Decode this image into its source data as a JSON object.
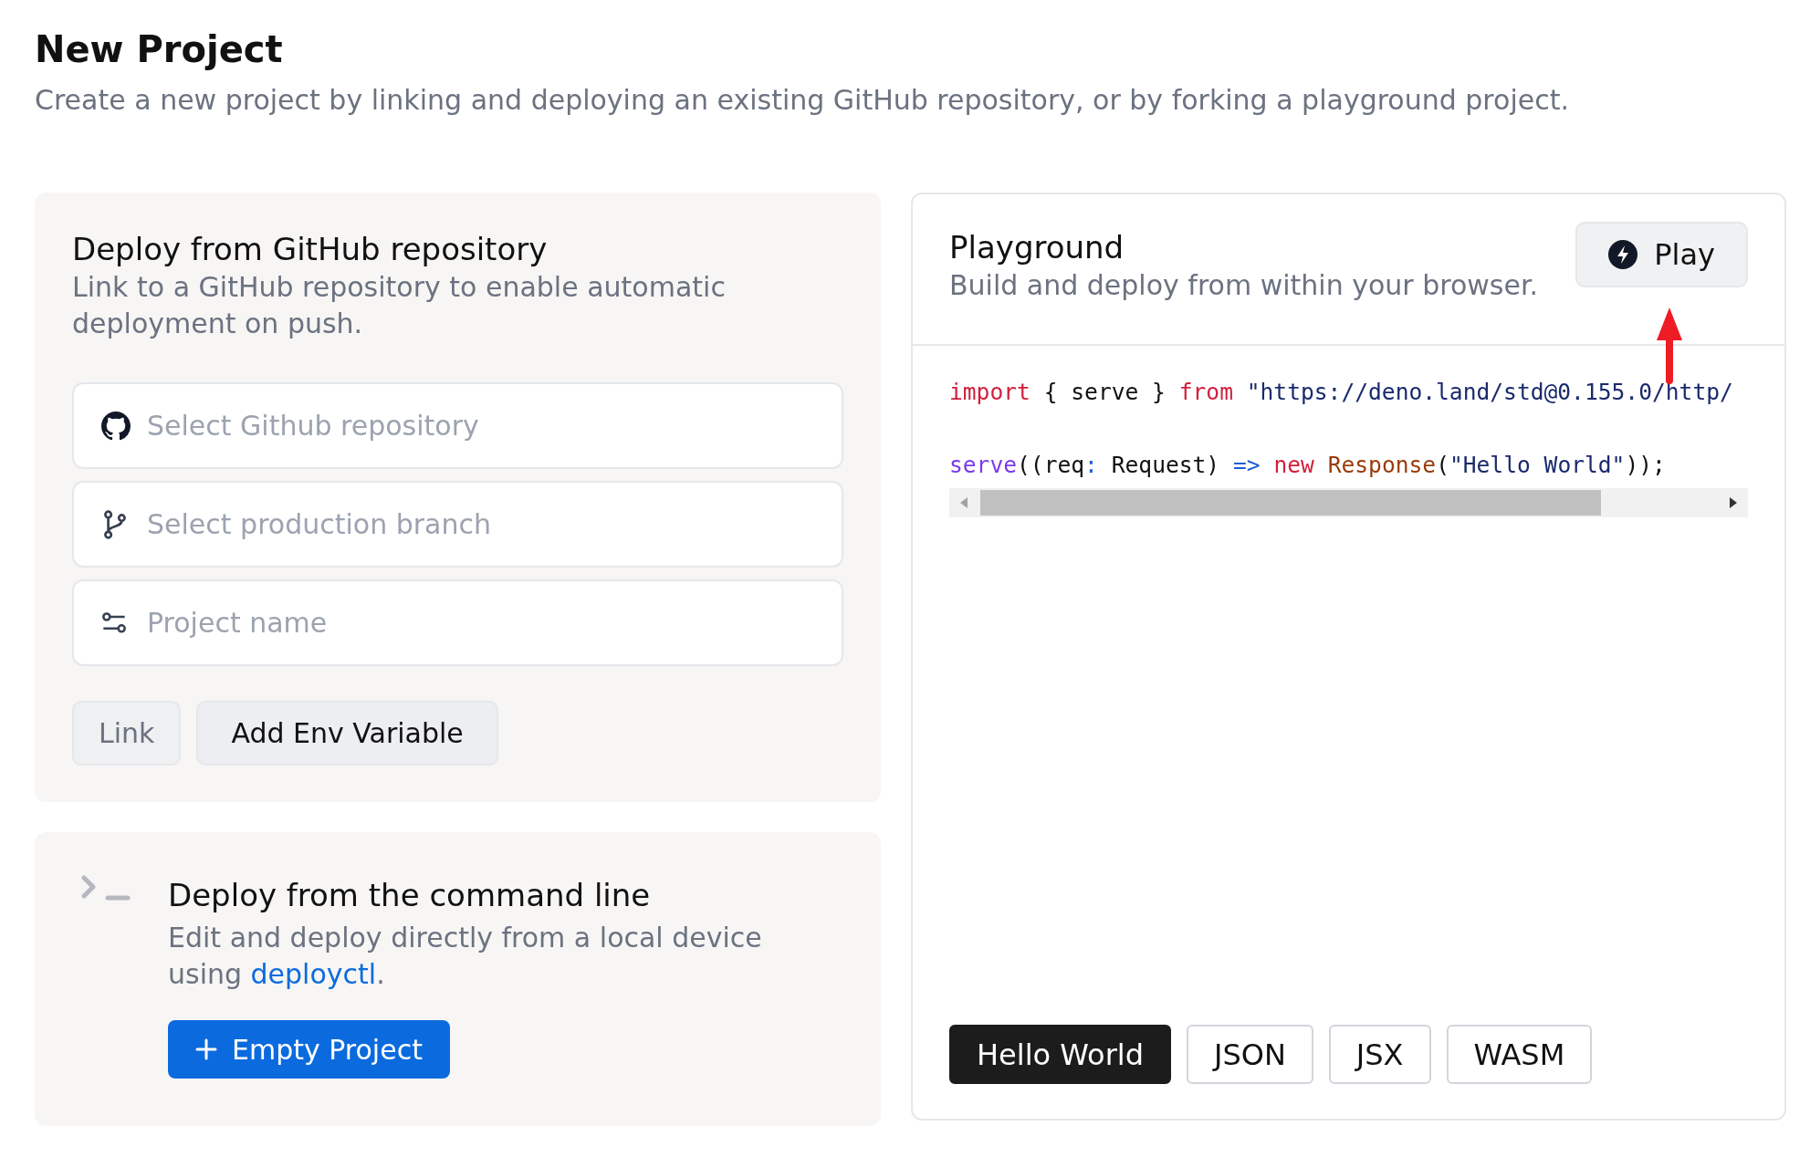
{
  "page": {
    "title": "New Project",
    "subtitle": "Create a new project by linking and deploying an existing GitHub repository, or by forking a playground project."
  },
  "github_card": {
    "title": "Deploy from GitHub repository",
    "description": "Link to a GitHub repository to enable automatic deployment on push.",
    "fields": [
      {
        "kind": "repo",
        "placeholder": "Select Github repository"
      },
      {
        "kind": "branch",
        "placeholder": "Select production branch"
      },
      {
        "kind": "name",
        "placeholder": "Project name"
      }
    ],
    "buttons": [
      {
        "label": "Link",
        "disabled": true
      },
      {
        "label": "Add Env Variable",
        "disabled": false
      }
    ]
  },
  "cli_card": {
    "title": "Deploy from the command line",
    "description": "Edit and deploy directly from a local device using ",
    "link": "deployctl",
    "description_end": ".",
    "button": "Empty Project"
  },
  "playground": {
    "title": "Playground",
    "description": "Build and deploy from within your browser.",
    "play_button": "Play",
    "code_lines": [
      [
        {
          "kind": "keyword",
          "text": "import"
        },
        {
          "kind": "plain",
          "text": " { serve } "
        },
        {
          "kind": "keyword",
          "text": "from"
        },
        {
          "kind": "string",
          "text": " \"https://deno.land/std@0.155.0/http/"
        }
      ],
      [
        {
          "kind": "func",
          "text": "serve"
        },
        {
          "kind": "plain",
          "text": "((req"
        },
        {
          "kind": "op",
          "text": ":"
        },
        {
          "kind": "plain",
          "text": " Request) "
        },
        {
          "kind": "op",
          "text": "=>"
        },
        {
          "kind": "keyword",
          "text": " new "
        },
        {
          "kind": "class",
          "text": "Response"
        },
        {
          "kind": "plain",
          "text": "("
        },
        {
          "kind": "string",
          "text": "\"Hello World\""
        },
        {
          "kind": "plain",
          "text": "));"
        }
      ]
    ],
    "templates": [
      {
        "label": "Hello World",
        "selected": true
      },
      {
        "label": "JSON",
        "selected": false
      },
      {
        "label": "JSX",
        "selected": false
      },
      {
        "label": "WASM",
        "selected": false
      }
    ]
  }
}
